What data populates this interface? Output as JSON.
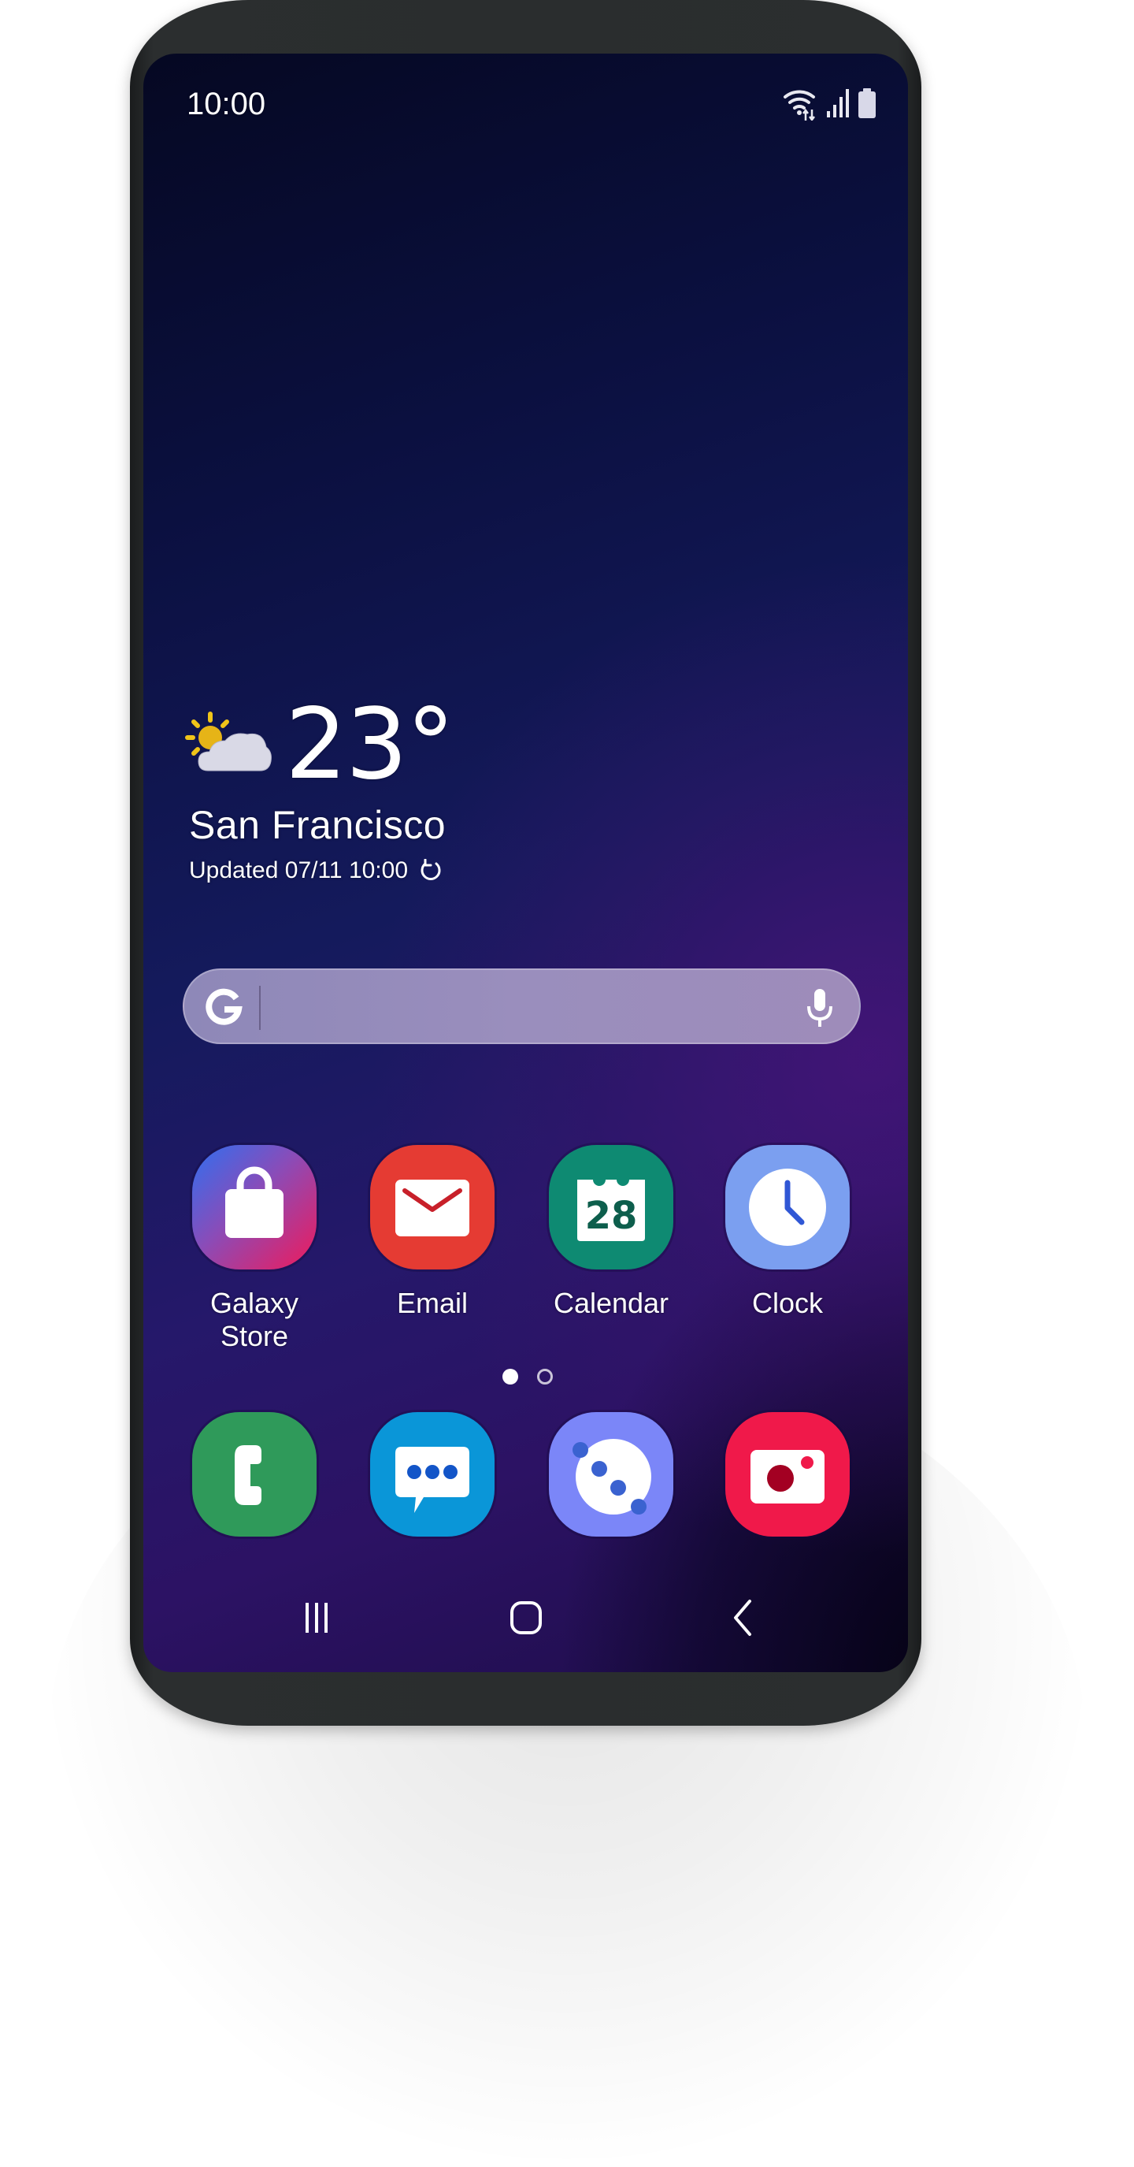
{
  "status_bar": {
    "time": "10:00",
    "icons": [
      "wifi-data-icon",
      "cellular-signal-icon",
      "battery-icon"
    ]
  },
  "weather": {
    "condition_icon": "partly-cloudy-icon",
    "temperature": "23°",
    "city": "San Francisco",
    "updated": "Updated 07/11 10:00",
    "refresh_icon": "refresh-icon"
  },
  "search_bar": {
    "logo_icon": "google-g-icon",
    "value": "",
    "voice_icon": "microphone-icon"
  },
  "home_apps": [
    {
      "label": "Galaxy\nStore",
      "icon": "shopping-bag-icon",
      "color": "#e0205a"
    },
    {
      "label": "Email",
      "icon": "envelope-icon",
      "color": "#e53b33"
    },
    {
      "label": "Calendar",
      "icon": "calendar-icon",
      "date": "28",
      "color": "#0e8a72"
    },
    {
      "label": "Clock",
      "icon": "clock-icon",
      "color": "#7b9ff0"
    }
  ],
  "page_indicator": {
    "current_page": 1,
    "total_pages": 2
  },
  "dock_apps": [
    {
      "name": "Phone",
      "icon": "phone-icon",
      "color": "#2f9a5a"
    },
    {
      "name": "Messages",
      "icon": "message-bubble-icon",
      "color": "#0a96d8"
    },
    {
      "name": "Internet",
      "icon": "internet-planet-icon",
      "color": "#7b86f8"
    },
    {
      "name": "Camera",
      "icon": "camera-icon",
      "color": "#f0194a"
    }
  ],
  "navigation_bar": {
    "recents": "recents-icon",
    "home": "home-icon",
    "back": "back-icon"
  }
}
